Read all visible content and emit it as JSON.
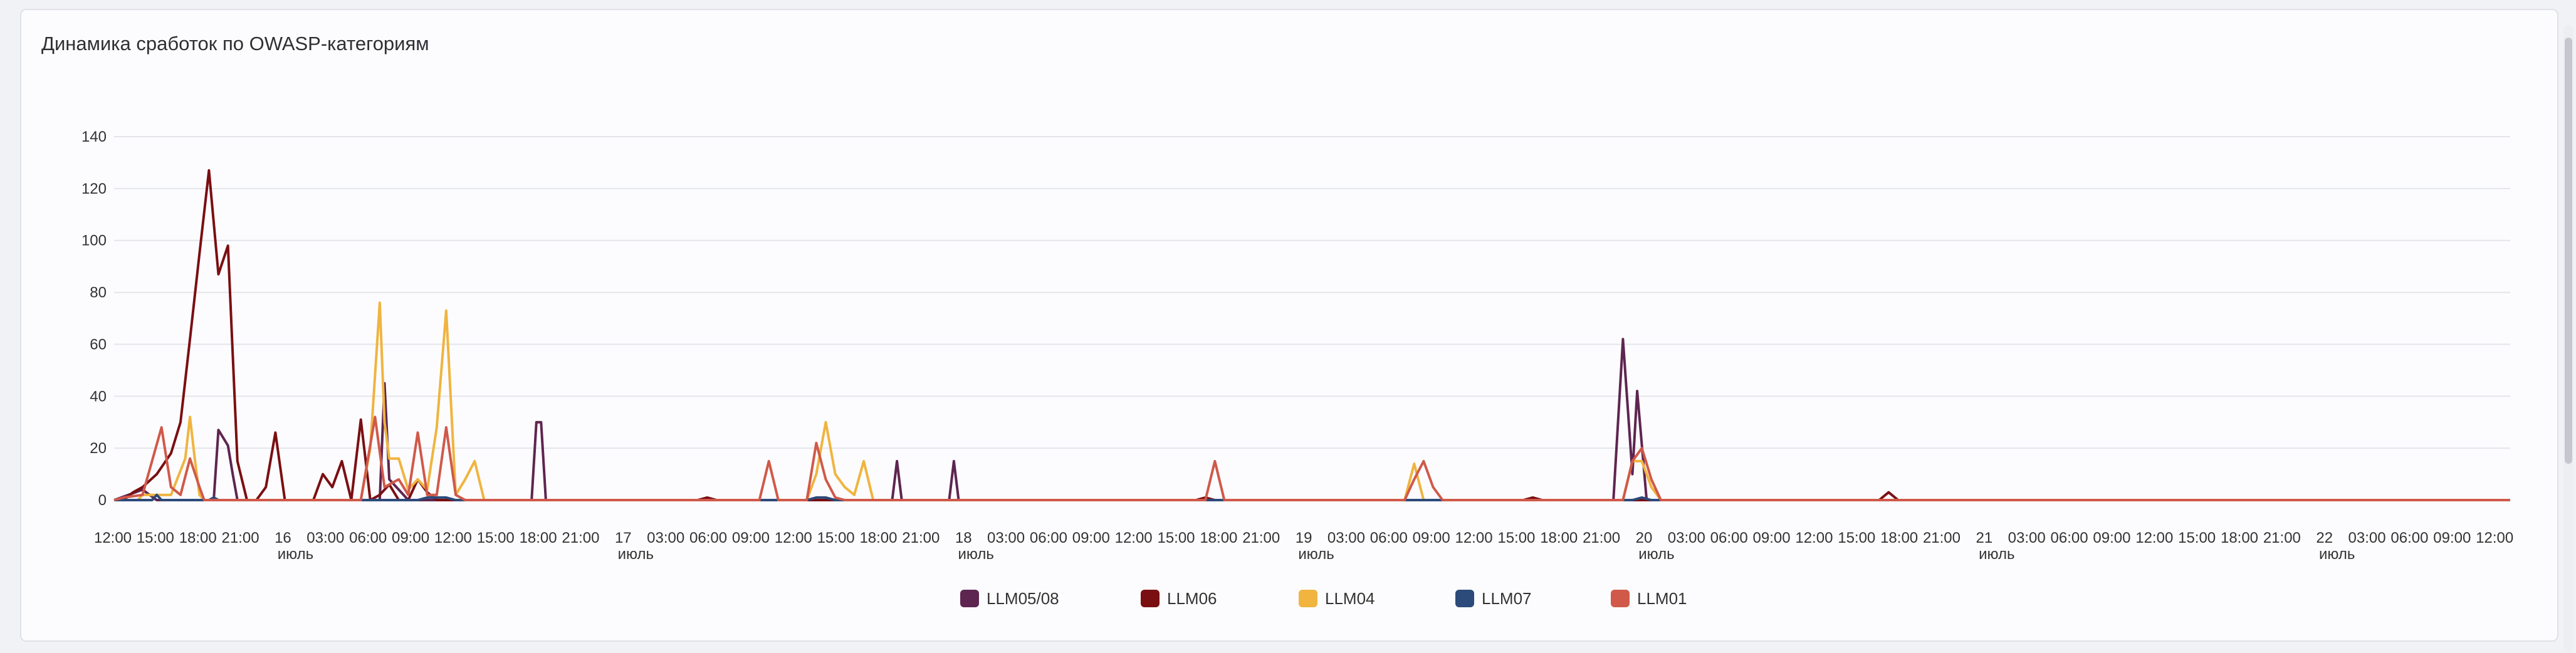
{
  "chart_data": {
    "type": "line",
    "title": "Динамика сработок по OWASP-категориям",
    "xlabel": "",
    "ylabel": "",
    "ylim": [
      0,
      140
    ],
    "yticks": [
      0,
      20,
      40,
      60,
      80,
      100,
      120,
      140
    ],
    "grid": true,
    "legend_position": "bottom",
    "x_tick_labels": [
      {
        "main": "12:00"
      },
      {
        "main": "15:00"
      },
      {
        "main": "18:00"
      },
      {
        "main": "21:00"
      },
      {
        "main": "16",
        "sub": "июль"
      },
      {
        "main": "03:00"
      },
      {
        "main": "06:00"
      },
      {
        "main": "09:00"
      },
      {
        "main": "12:00"
      },
      {
        "main": "15:00"
      },
      {
        "main": "18:00"
      },
      {
        "main": "21:00"
      },
      {
        "main": "17",
        "sub": "июль"
      },
      {
        "main": "03:00"
      },
      {
        "main": "06:00"
      },
      {
        "main": "09:00"
      },
      {
        "main": "12:00"
      },
      {
        "main": "15:00"
      },
      {
        "main": "18:00"
      },
      {
        "main": "21:00"
      },
      {
        "main": "18",
        "sub": "июль"
      },
      {
        "main": "03:00"
      },
      {
        "main": "06:00"
      },
      {
        "main": "09:00"
      },
      {
        "main": "12:00"
      },
      {
        "main": "15:00"
      },
      {
        "main": "18:00"
      },
      {
        "main": "21:00"
      },
      {
        "main": "19",
        "sub": "июль"
      },
      {
        "main": "03:00"
      },
      {
        "main": "06:00"
      },
      {
        "main": "09:00"
      },
      {
        "main": "12:00"
      },
      {
        "main": "15:00"
      },
      {
        "main": "18:00"
      },
      {
        "main": "21:00"
      },
      {
        "main": "20",
        "sub": "июль"
      },
      {
        "main": "03:00"
      },
      {
        "main": "06:00"
      },
      {
        "main": "09:00"
      },
      {
        "main": "12:00"
      },
      {
        "main": "15:00"
      },
      {
        "main": "18:00"
      },
      {
        "main": "21:00"
      },
      {
        "main": "21",
        "sub": "июль"
      },
      {
        "main": "03:00"
      },
      {
        "main": "06:00"
      },
      {
        "main": "09:00"
      },
      {
        "main": "12:00"
      },
      {
        "main": "15:00"
      },
      {
        "main": "18:00"
      },
      {
        "main": "21:00"
      },
      {
        "main": "22",
        "sub": "июль"
      },
      {
        "main": "03:00"
      },
      {
        "main": "06:00"
      },
      {
        "main": "09:00"
      },
      {
        "main": "12:00"
      }
    ],
    "x_hours_range": [
      0,
      168
    ],
    "series": [
      {
        "name": "LLM05/08",
        "color": "#5e2550",
        "points": [
          [
            0,
            0
          ],
          [
            3,
            2
          ],
          [
            6,
            4
          ],
          [
            9,
            0
          ],
          [
            21,
            0
          ],
          [
            22,
            27
          ],
          [
            24,
            21
          ],
          [
            25,
            10
          ],
          [
            26,
            0
          ],
          [
            56,
            0
          ],
          [
            57,
            45
          ],
          [
            58,
            8
          ],
          [
            60,
            4
          ],
          [
            62,
            0
          ],
          [
            88,
            0
          ],
          [
            89,
            30
          ],
          [
            90,
            30
          ],
          [
            91,
            0
          ],
          [
            164,
            0
          ],
          [
            165,
            15
          ],
          [
            166,
            0
          ],
          [
            176,
            0
          ],
          [
            177,
            15
          ],
          [
            178,
            0
          ],
          [
            316,
            0
          ],
          [
            318,
            62
          ],
          [
            320,
            10
          ],
          [
            321,
            42
          ],
          [
            323,
            0
          ],
          [
            505,
            0
          ]
        ]
      },
      {
        "name": "LLM06",
        "color": "#7a0f12",
        "points": [
          [
            0,
            0
          ],
          [
            2,
            0
          ],
          [
            4,
            3
          ],
          [
            6,
            5
          ],
          [
            9,
            10
          ],
          [
            12,
            18
          ],
          [
            14,
            30
          ],
          [
            16,
            62
          ],
          [
            18,
            95
          ],
          [
            20,
            127
          ],
          [
            22,
            87
          ],
          [
            24,
            98
          ],
          [
            26,
            15
          ],
          [
            28,
            0
          ],
          [
            30,
            0
          ],
          [
            32,
            5
          ],
          [
            34,
            26
          ],
          [
            36,
            0
          ],
          [
            42,
            0
          ],
          [
            44,
            10
          ],
          [
            46,
            5
          ],
          [
            48,
            15
          ],
          [
            50,
            0
          ],
          [
            52,
            31
          ],
          [
            54,
            0
          ],
          [
            56,
            2
          ],
          [
            58,
            6
          ],
          [
            60,
            0
          ],
          [
            62,
            0
          ],
          [
            64,
            8
          ],
          [
            66,
            3
          ],
          [
            68,
            0
          ],
          [
            123,
            0
          ],
          [
            125,
            1
          ],
          [
            127,
            0
          ],
          [
            228,
            0
          ],
          [
            230,
            1
          ],
          [
            232,
            0
          ],
          [
            297,
            0
          ],
          [
            299,
            1
          ],
          [
            301,
            0
          ],
          [
            372,
            0
          ],
          [
            374,
            3
          ],
          [
            376,
            0
          ],
          [
            505,
            0
          ]
        ]
      },
      {
        "name": "LLM04",
        "color": "#f0b43f",
        "points": [
          [
            0,
            0
          ],
          [
            2,
            0
          ],
          [
            5,
            0
          ],
          [
            6,
            2
          ],
          [
            12,
            2
          ],
          [
            15,
            16
          ],
          [
            16,
            32
          ],
          [
            17,
            16
          ],
          [
            18,
            2
          ],
          [
            19,
            0
          ],
          [
            52,
            0
          ],
          [
            54,
            20
          ],
          [
            56,
            76
          ],
          [
            57,
            30
          ],
          [
            58,
            16
          ],
          [
            60,
            16
          ],
          [
            62,
            4
          ],
          [
            64,
            8
          ],
          [
            66,
            4
          ],
          [
            68,
            28
          ],
          [
            70,
            73
          ],
          [
            72,
            2
          ],
          [
            74,
            8
          ],
          [
            76,
            15
          ],
          [
            78,
            0
          ],
          [
            146,
            0
          ],
          [
            148,
            10
          ],
          [
            150,
            30
          ],
          [
            152,
            10
          ],
          [
            154,
            5
          ],
          [
            156,
            2
          ],
          [
            158,
            15
          ],
          [
            160,
            0
          ],
          [
            272,
            0
          ],
          [
            274,
            14
          ],
          [
            276,
            0
          ],
          [
            318,
            0
          ],
          [
            320,
            15
          ],
          [
            322,
            15
          ],
          [
            324,
            5
          ],
          [
            326,
            0
          ],
          [
            505,
            0
          ]
        ]
      },
      {
        "name": "LLM07",
        "color": "#2c4a7a",
        "points": [
          [
            0,
            0
          ],
          [
            8,
            0
          ],
          [
            9,
            2
          ],
          [
            10,
            0
          ],
          [
            20,
            0
          ],
          [
            21,
            1
          ],
          [
            22,
            0
          ],
          [
            64,
            0
          ],
          [
            66,
            1
          ],
          [
            68,
            1
          ],
          [
            70,
            1
          ],
          [
            72,
            0
          ],
          [
            146,
            0
          ],
          [
            148,
            1
          ],
          [
            150,
            1
          ],
          [
            152,
            0
          ],
          [
            320,
            0
          ],
          [
            322,
            1
          ],
          [
            324,
            0
          ],
          [
            505,
            0
          ]
        ]
      },
      {
        "name": "LLM01",
        "color": "#d0594a",
        "points": [
          [
            0,
            0
          ],
          [
            2,
            1
          ],
          [
            6,
            2
          ],
          [
            10,
            28
          ],
          [
            12,
            5
          ],
          [
            14,
            2
          ],
          [
            16,
            16
          ],
          [
            18,
            5
          ],
          [
            19,
            0
          ],
          [
            52,
            0
          ],
          [
            55,
            32
          ],
          [
            57,
            5
          ],
          [
            60,
            8
          ],
          [
            62,
            2
          ],
          [
            64,
            26
          ],
          [
            66,
            2
          ],
          [
            68,
            2
          ],
          [
            70,
            28
          ],
          [
            72,
            2
          ],
          [
            74,
            0
          ],
          [
            136,
            0
          ],
          [
            138,
            15
          ],
          [
            140,
            0
          ],
          [
            146,
            0
          ],
          [
            148,
            22
          ],
          [
            150,
            8
          ],
          [
            152,
            1
          ],
          [
            154,
            0
          ],
          [
            230,
            0
          ],
          [
            232,
            15
          ],
          [
            234,
            0
          ],
          [
            272,
            0
          ],
          [
            274,
            8
          ],
          [
            276,
            15
          ],
          [
            278,
            5
          ],
          [
            280,
            0
          ],
          [
            318,
            0
          ],
          [
            320,
            15
          ],
          [
            322,
            20
          ],
          [
            324,
            8
          ],
          [
            326,
            0
          ],
          [
            505,
            0
          ]
        ]
      }
    ]
  }
}
